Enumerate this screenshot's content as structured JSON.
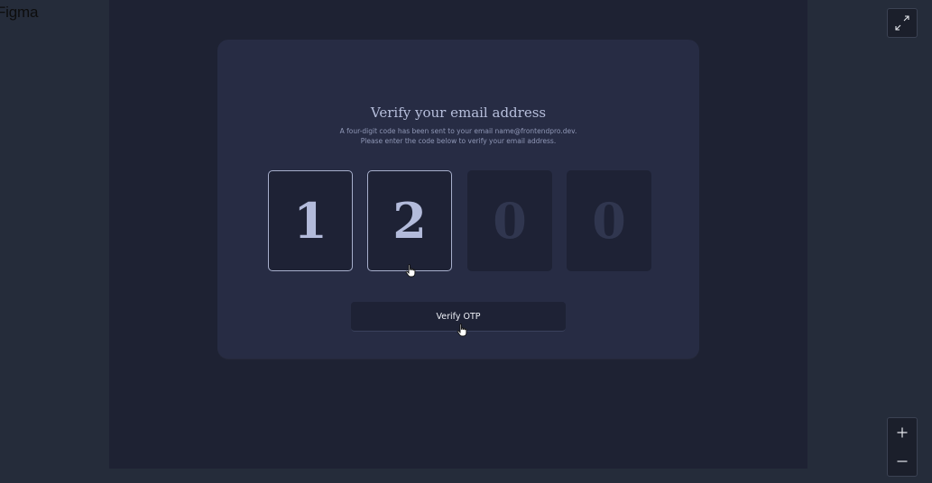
{
  "app": {
    "brand": "Figma"
  },
  "card": {
    "title": "Verify your email address",
    "subtitle_line1": "A four-digit code has been sent to your email name@frontendpro.dev.",
    "subtitle_line2": "Please enter the code below to verify your email address."
  },
  "otp": {
    "digits": [
      "1",
      "2",
      "0",
      "0"
    ],
    "filled": [
      true,
      true,
      false,
      false
    ]
  },
  "button": {
    "label": "Verify OTP"
  },
  "toolbar": {
    "expand_icon": "expand-icon",
    "zoom_in_icon": "plus-icon",
    "zoom_out_icon": "minus-icon"
  },
  "colors": {
    "background": "#252c3a",
    "frame": "#1e2233",
    "card": "#272c44",
    "input": "#1e2235",
    "filled_digit": "#b3bbdb",
    "placeholder_digit": "#30364f"
  }
}
